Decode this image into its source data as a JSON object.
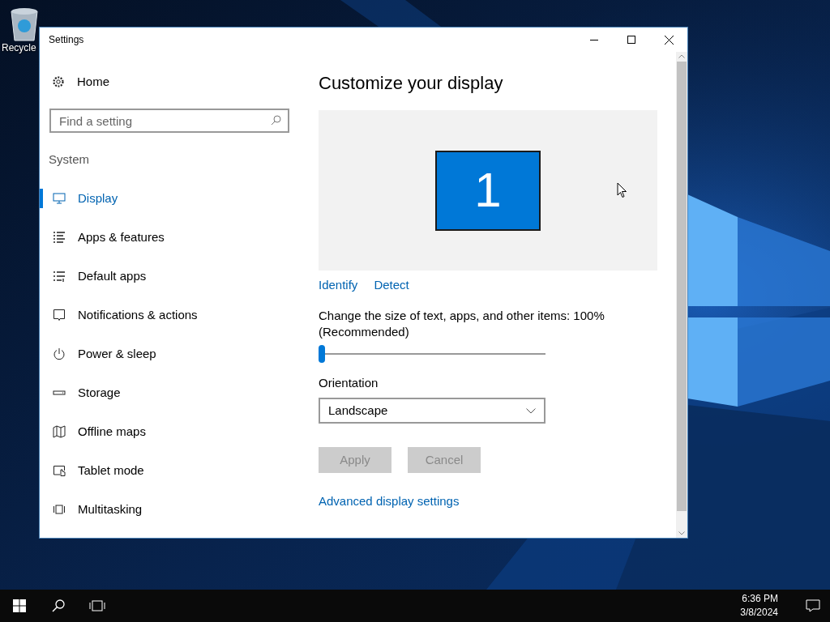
{
  "desktop": {
    "icons": [
      {
        "label": "Recycle"
      }
    ]
  },
  "window": {
    "title": "Settings"
  },
  "sidebar": {
    "home": "Home",
    "search": {
      "placeholder": "Find a setting"
    },
    "section": "System",
    "items": [
      {
        "label": "Display",
        "kind": "display",
        "selected": true
      },
      {
        "label": "Apps & features",
        "kind": "apps",
        "selected": false
      },
      {
        "label": "Default apps",
        "kind": "defaults",
        "selected": false
      },
      {
        "label": "Notifications & actions",
        "kind": "notify",
        "selected": false
      },
      {
        "label": "Power & sleep",
        "kind": "power",
        "selected": false
      },
      {
        "label": "Storage",
        "kind": "storage",
        "selected": false
      },
      {
        "label": "Offline maps",
        "kind": "maps",
        "selected": false
      },
      {
        "label": "Tablet mode",
        "kind": "tablet",
        "selected": false
      },
      {
        "label": "Multitasking",
        "kind": "multi",
        "selected": false
      }
    ]
  },
  "content": {
    "heading": "Customize your display",
    "monitor": {
      "number": "1"
    },
    "links": [
      "Identify",
      "Detect"
    ],
    "scale": {
      "label": "Change the size of text, apps, and other items: 100% (Recommended)",
      "level": 0
    },
    "orientation": {
      "label": "Orientation",
      "value": "Landscape"
    },
    "buttons": [
      {
        "label": "Apply",
        "disabled": true
      },
      {
        "label": "Cancel",
        "disabled": true
      }
    ],
    "advanced_link": "Advanced display settings"
  },
  "taskbar": {
    "time": "6:36 PM",
    "date": "3/8/2024"
  }
}
